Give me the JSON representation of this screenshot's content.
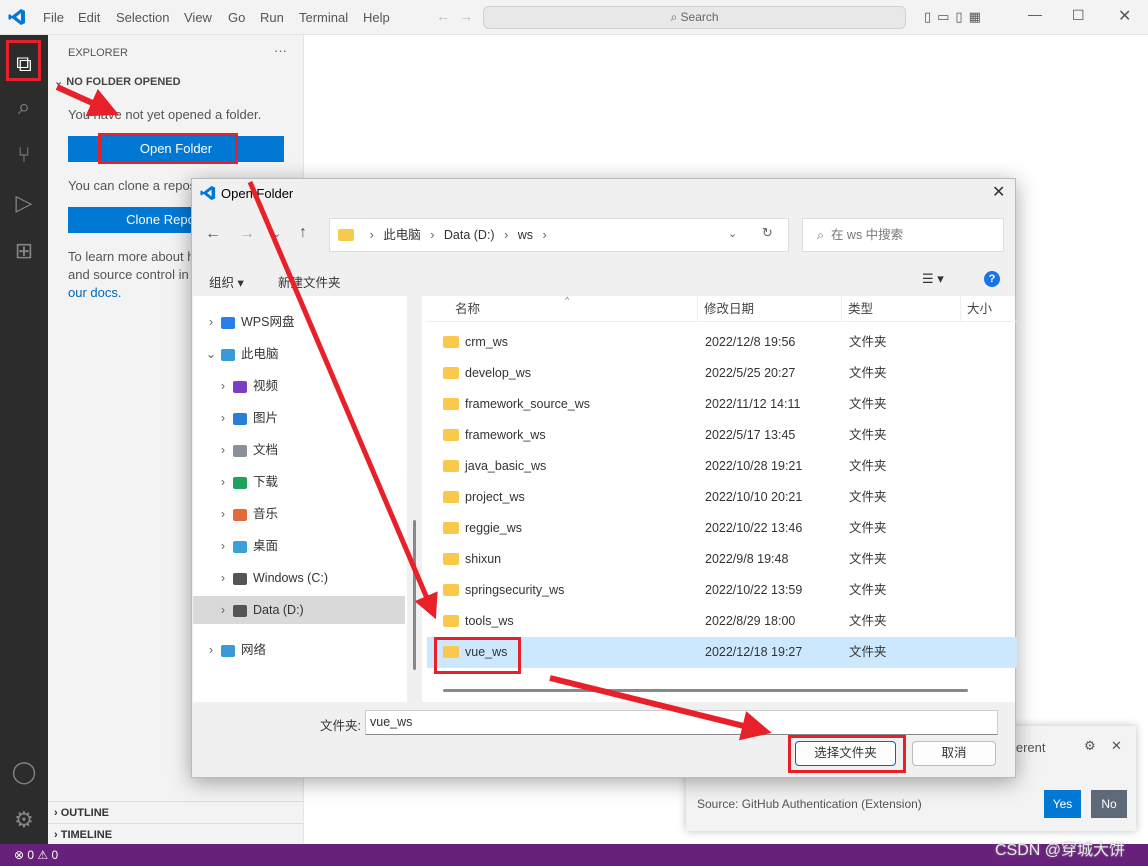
{
  "menu": [
    "File",
    "Edit",
    "Selection",
    "View",
    "Go",
    "Run",
    "Terminal",
    "Help"
  ],
  "search_label": "Search",
  "sidebar": {
    "title": "EXPLORER",
    "more": "···",
    "section": "NO FOLDER OPENED",
    "msg1": "You have not yet opened a folder.",
    "open_folder": "Open Folder",
    "msg2": "You can clone a repository locally.",
    "clone": "Clone Repository",
    "msg3a": "To learn more about how to use git",
    "msg3b": "and source control in VS Code read",
    "msg3c": "our docs.",
    "outline": "OUTLINE",
    "timeline": "TIMELINE"
  },
  "status": {
    "errors": "0",
    "warnings": "0"
  },
  "notification": {
    "text": "ifferent",
    "source": "Source: GitHub Authentication (Extension)",
    "yes": "Yes",
    "no": "No"
  },
  "dialog": {
    "title": "Open Folder",
    "breadcrumb": [
      "此电脑",
      "Data (D:)",
      "ws"
    ],
    "search_placeholder": "在 ws 中搜索",
    "organize": "组织 ▾",
    "new_folder": "新建文件夹",
    "columns": [
      "名称",
      "修改日期",
      "类型",
      "大小"
    ],
    "tree": [
      {
        "label": "WPS网盘",
        "color": "#2b7de9",
        "indent": 0,
        "chev": "›"
      },
      {
        "label": "此电脑",
        "color": "#3a9ad9",
        "indent": 0,
        "chev": "⌄"
      },
      {
        "label": "视频",
        "color": "#7b3fc4",
        "indent": 1,
        "chev": "›"
      },
      {
        "label": "图片",
        "color": "#2a7fd4",
        "indent": 1,
        "chev": "›"
      },
      {
        "label": "文档",
        "color": "#8a8f99",
        "indent": 1,
        "chev": "›"
      },
      {
        "label": "下载",
        "color": "#1ea35a",
        "indent": 1,
        "chev": "›"
      },
      {
        "label": "音乐",
        "color": "#e06a3a",
        "indent": 1,
        "chev": "›"
      },
      {
        "label": "桌面",
        "color": "#3aa0d8",
        "indent": 1,
        "chev": "›"
      },
      {
        "label": "Windows (C:)",
        "color": "#555",
        "indent": 1,
        "chev": "›"
      },
      {
        "label": "Data (D:)",
        "color": "#555",
        "indent": 1,
        "chev": "›",
        "selected": true
      },
      {
        "label": "网络",
        "color": "#3a9ad9",
        "indent": 0,
        "chev": "›"
      }
    ],
    "files": [
      {
        "name": "crm_ws",
        "date": "2022/12/8 19:56",
        "type": "文件夹"
      },
      {
        "name": "develop_ws",
        "date": "2022/5/25 20:27",
        "type": "文件夹"
      },
      {
        "name": "framework_source_ws",
        "date": "2022/11/12 14:11",
        "type": "文件夹"
      },
      {
        "name": "framework_ws",
        "date": "2022/5/17 13:45",
        "type": "文件夹"
      },
      {
        "name": "java_basic_ws",
        "date": "2022/10/28 19:21",
        "type": "文件夹"
      },
      {
        "name": "project_ws",
        "date": "2022/10/10 20:21",
        "type": "文件夹"
      },
      {
        "name": "reggie_ws",
        "date": "2022/10/22 13:46",
        "type": "文件夹"
      },
      {
        "name": "shixun",
        "date": "2022/9/8 19:48",
        "type": "文件夹"
      },
      {
        "name": "springsecurity_ws",
        "date": "2022/10/22 13:59",
        "type": "文件夹"
      },
      {
        "name": "tools_ws",
        "date": "2022/8/29 18:00",
        "type": "文件夹"
      },
      {
        "name": "vue_ws",
        "date": "2022/12/18 19:27",
        "type": "文件夹",
        "selected": true
      }
    ],
    "filename_label": "文件夹:",
    "filename_value": "vue_ws",
    "select_button": "选择文件夹",
    "cancel_button": "取消"
  },
  "watermark": "CSDN @穿城大饼",
  "colors": {
    "accent": "#0078d4",
    "status": "#68217a",
    "annotation": "#e8202a"
  }
}
